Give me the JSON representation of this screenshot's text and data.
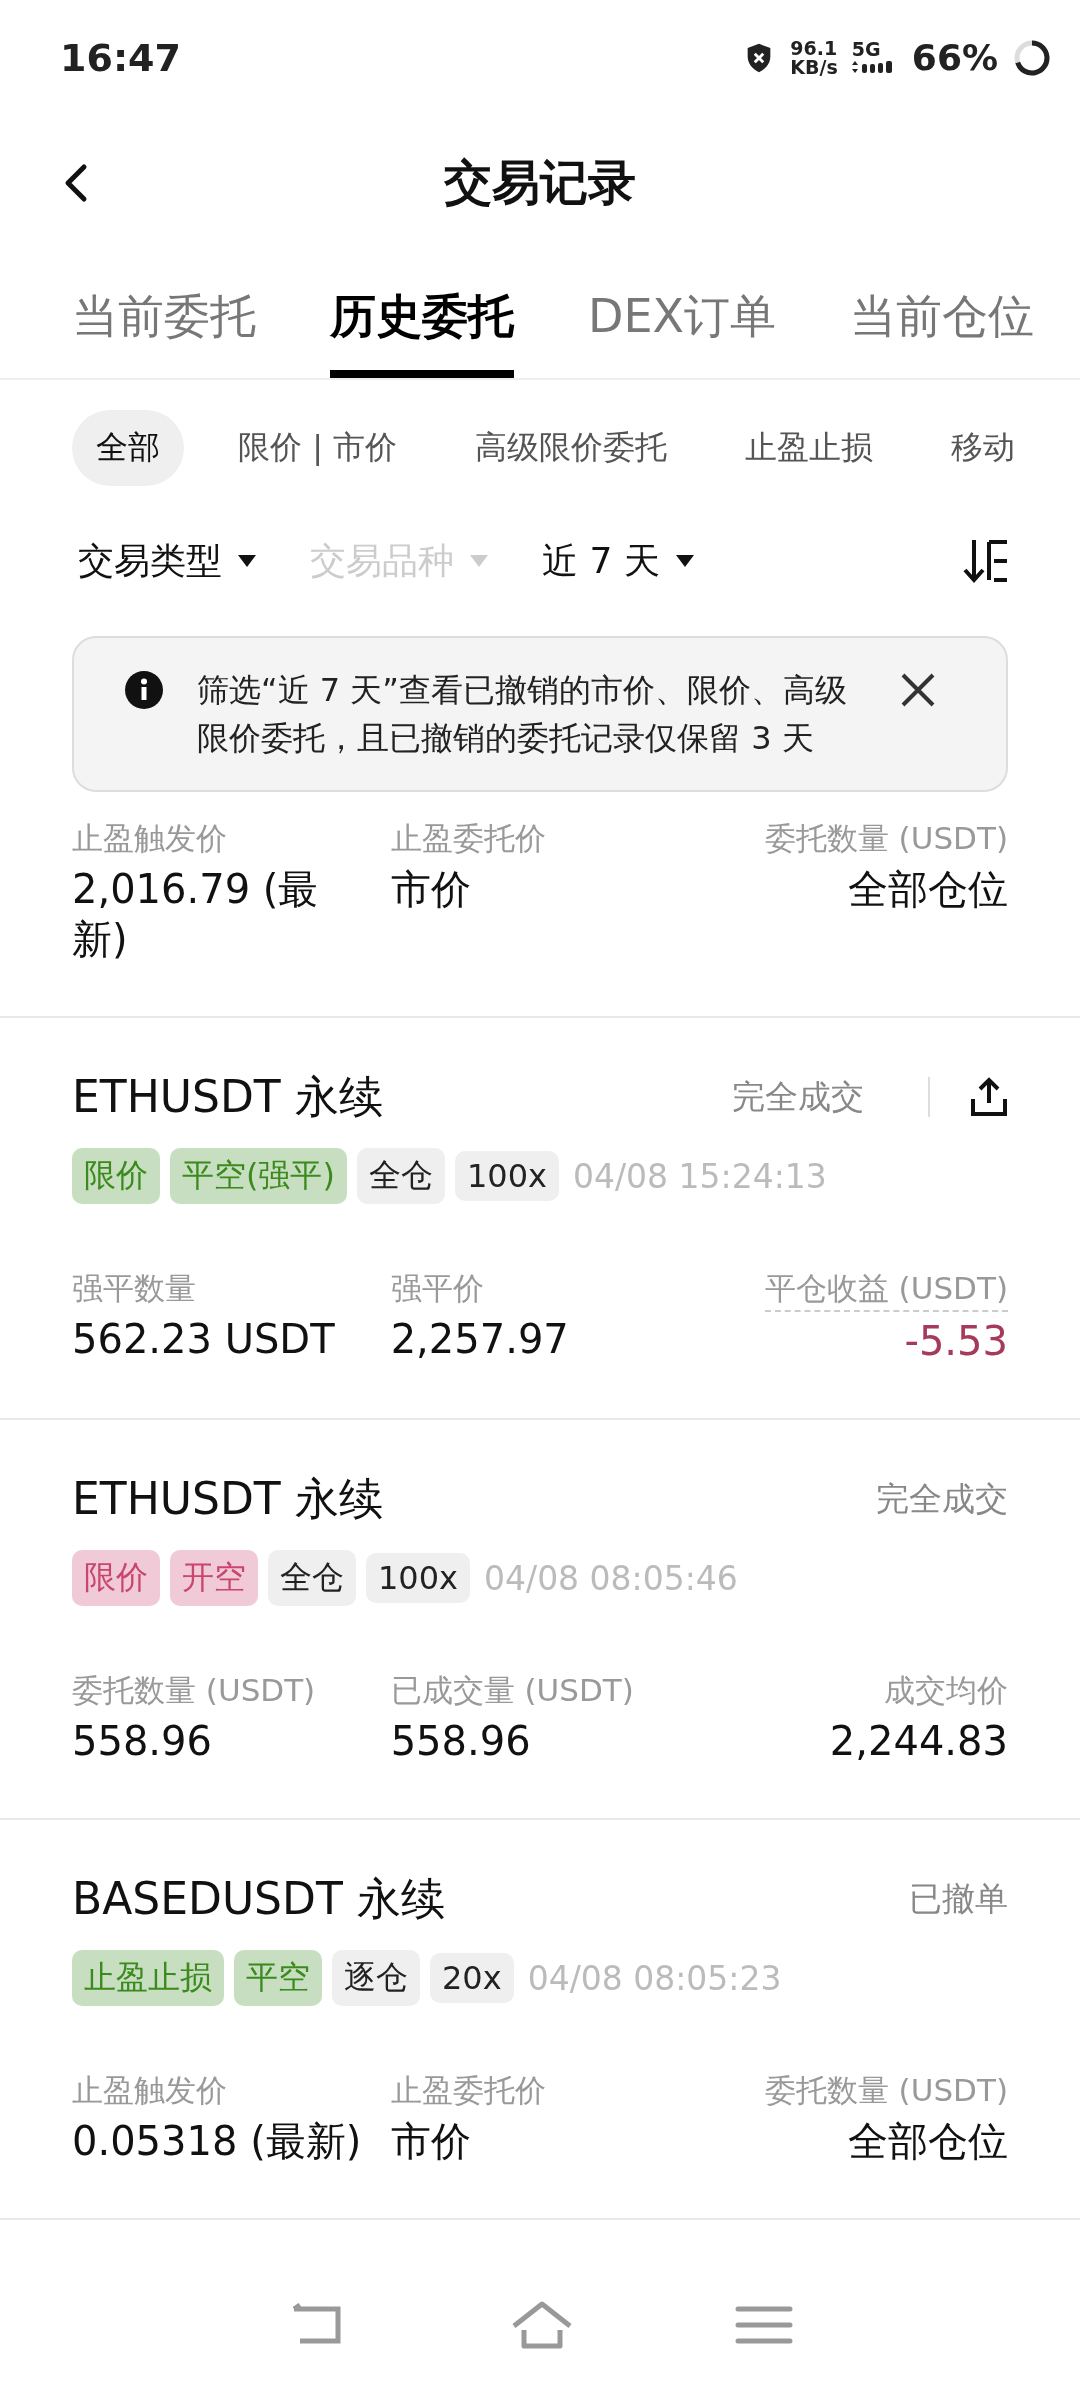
{
  "status_bar": {
    "time": "16:47",
    "speed": "96.1",
    "speed_unit": "KB/s",
    "network": "5G",
    "battery": "66%"
  },
  "header": {
    "title": "交易记录"
  },
  "tabs": [
    {
      "label": "当前委托",
      "selected": false
    },
    {
      "label": "历史委托",
      "selected": true
    },
    {
      "label": "DEX订单",
      "selected": false
    },
    {
      "label": "当前仓位",
      "selected": false
    }
  ],
  "chips": [
    {
      "label": "全部",
      "selected": true
    },
    {
      "label": "限价 | 市价",
      "selected": false
    },
    {
      "label": "高级限价委托",
      "selected": false
    },
    {
      "label": "止盈止损",
      "selected": false
    },
    {
      "label": "移动",
      "selected": false
    }
  ],
  "filters": [
    {
      "label": "交易类型",
      "disabled": false
    },
    {
      "label": "交易品种",
      "disabled": true
    },
    {
      "label": "近 7 天",
      "disabled": false
    }
  ],
  "notice": {
    "text": "筛选“近 7 天”查看已撤销的市价、限价、高级限价委托，且已撤销的委托记录仅保留 3 天"
  },
  "records": [
    {
      "fields": [
        {
          "label": "止盈触发价",
          "value": "2,016.79 (最新)"
        },
        {
          "label": "止盈委托价",
          "value": "市价"
        },
        {
          "label": "委托数量 (USDT)",
          "value": "全部仓位"
        }
      ]
    },
    {
      "title": "ETHUSDT 永续",
      "status": "完全成交",
      "share": true,
      "time": "04/08 15:24:13",
      "tags": [
        {
          "label": "限价",
          "kind": "side",
          "color": "#3b8a1e"
        },
        {
          "label": "平空(强平)",
          "kind": "side",
          "color": "#3b8a1e"
        },
        {
          "label": "全仓",
          "kind": "plain"
        },
        {
          "label": "100x",
          "kind": "plain"
        }
      ],
      "fields": [
        {
          "label": "强平数量",
          "value": "562.23 USDT"
        },
        {
          "label": "强平价",
          "value": "2,257.97"
        },
        {
          "label": "平仓收益 (USDT)",
          "value": "-5.53",
          "dashed": true,
          "negative": true
        }
      ]
    },
    {
      "title": "ETHUSDT 永续",
      "status": "完全成交",
      "share": false,
      "time": "04/08 08:05:46",
      "tags": [
        {
          "label": "限价",
          "kind": "side",
          "color": "#c8466f"
        },
        {
          "label": "开空",
          "kind": "side",
          "color": "#c8466f"
        },
        {
          "label": "全仓",
          "kind": "plain"
        },
        {
          "label": "100x",
          "kind": "plain"
        }
      ],
      "fields": [
        {
          "label": "委托数量 (USDT)",
          "value": "558.96"
        },
        {
          "label": "已成交量 (USDT)",
          "value": "558.96"
        },
        {
          "label": "成交均价",
          "value": "2,244.83"
        }
      ]
    },
    {
      "title": "BASEDUSDT 永续",
      "status": "已撤单",
      "share": false,
      "time": "04/08 08:05:23",
      "tags": [
        {
          "label": "止盈止损",
          "kind": "side",
          "color": "#3b8a1e"
        },
        {
          "label": "平空",
          "kind": "side",
          "color": "#3b8a1e"
        },
        {
          "label": "逐仓",
          "kind": "plain"
        },
        {
          "label": "20x",
          "kind": "plain"
        }
      ],
      "fields": [
        {
          "label": "止盈触发价",
          "value": "0.05318 (最新)"
        },
        {
          "label": "止盈委托价",
          "value": "市价"
        },
        {
          "label": "委托数量 (USDT)",
          "value": "全部仓位"
        }
      ]
    }
  ]
}
